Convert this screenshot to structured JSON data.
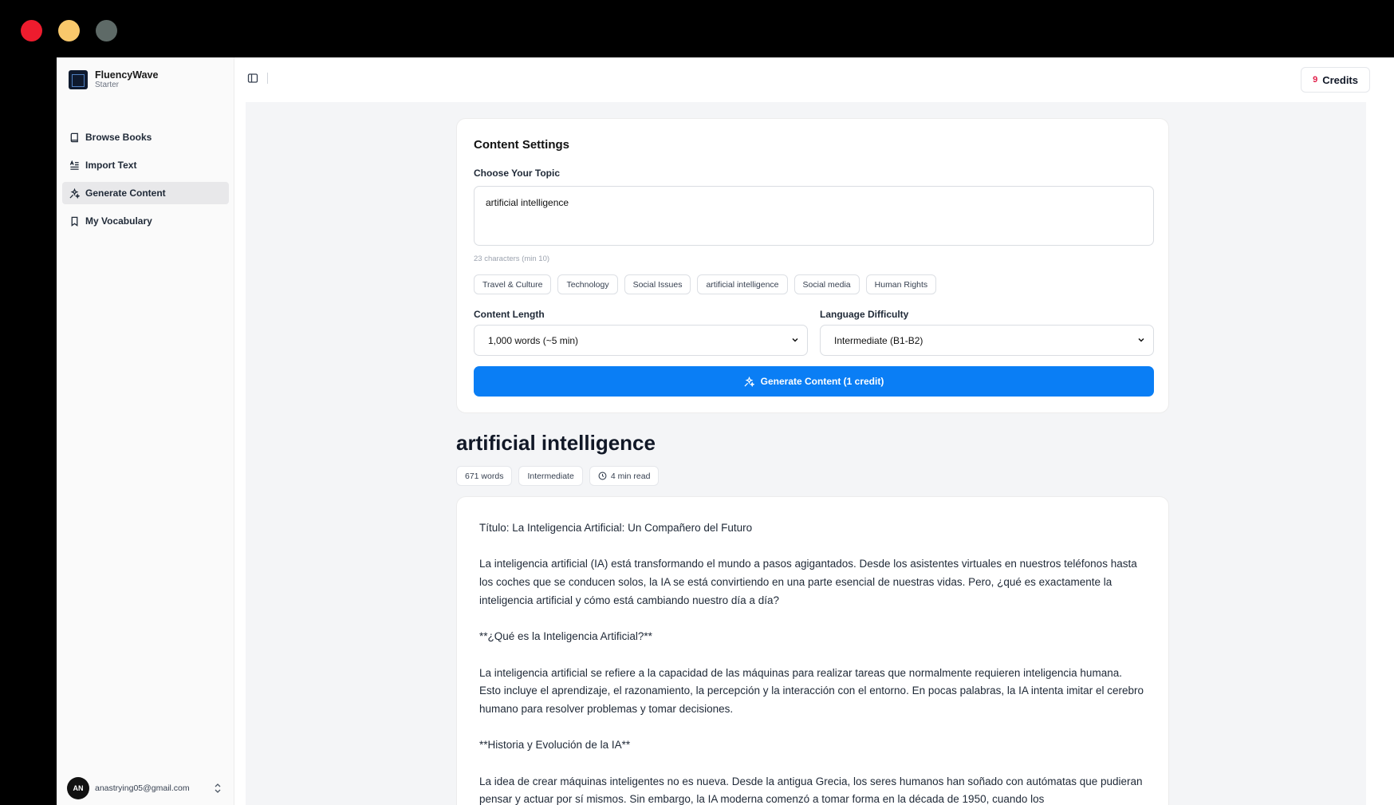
{
  "brand": {
    "name": "FluencyWave",
    "plan": "Starter"
  },
  "nav": [
    {
      "label": "Browse Books",
      "icon": "book-icon"
    },
    {
      "label": "Import Text",
      "icon": "import-text-icon"
    },
    {
      "label": "Generate Content",
      "icon": "sparkles-icon",
      "active": true
    },
    {
      "label": "My Vocabulary",
      "icon": "bookmark-icon"
    }
  ],
  "user": {
    "initials": "AN",
    "email": "anastrying05@gmail.com"
  },
  "header": {
    "credits_count": "9",
    "credits_label": "Credits"
  },
  "settings": {
    "title": "Content Settings",
    "topic_label": "Choose Your Topic",
    "topic_value": "artificial intelligence",
    "char_count": "23 characters (min 10)",
    "chips": [
      "Travel & Culture",
      "Technology",
      "Social Issues",
      "artificial intelligence",
      "Social media",
      "Human Rights"
    ],
    "length_label": "Content Length",
    "length_value": "1,000 words (~5 min)",
    "difficulty_label": "Language Difficulty",
    "difficulty_value": "Intermediate (B1-B2)",
    "generate_label": "Generate Content (1 credit)"
  },
  "article": {
    "title": "artificial intelligence",
    "word_count": "671 words",
    "level": "Intermediate",
    "read_time": "4 min read",
    "paragraphs": [
      "Título: La Inteligencia Artificial: Un Compañero del Futuro",
      "La inteligencia artificial (IA) está transformando el mundo a pasos agigantados. Desde los asistentes virtuales en nuestros teléfonos hasta los coches que se conducen solos, la IA se está convirtiendo en una parte esencial de nuestras vidas. Pero, ¿qué es exactamente la inteligencia artificial y cómo está cambiando nuestro día a día?",
      "**¿Qué es la Inteligencia Artificial?**",
      "La inteligencia artificial se refiere a la capacidad de las máquinas para realizar tareas que normalmente requieren inteligencia humana. Esto incluye el aprendizaje, el razonamiento, la percepción y la interacción con el entorno. En pocas palabras, la IA intenta imitar el cerebro humano para resolver problemas y tomar decisiones.",
      "**Historia y Evolución de la IA**",
      "La idea de crear máquinas inteligentes no es nueva. Desde la antigua Grecia, los seres humanos han soñado con autómatas que pudieran pensar y actuar por sí mismos. Sin embargo, la IA moderna comenzó a tomar forma en la década de 1950, cuando los"
    ]
  }
}
